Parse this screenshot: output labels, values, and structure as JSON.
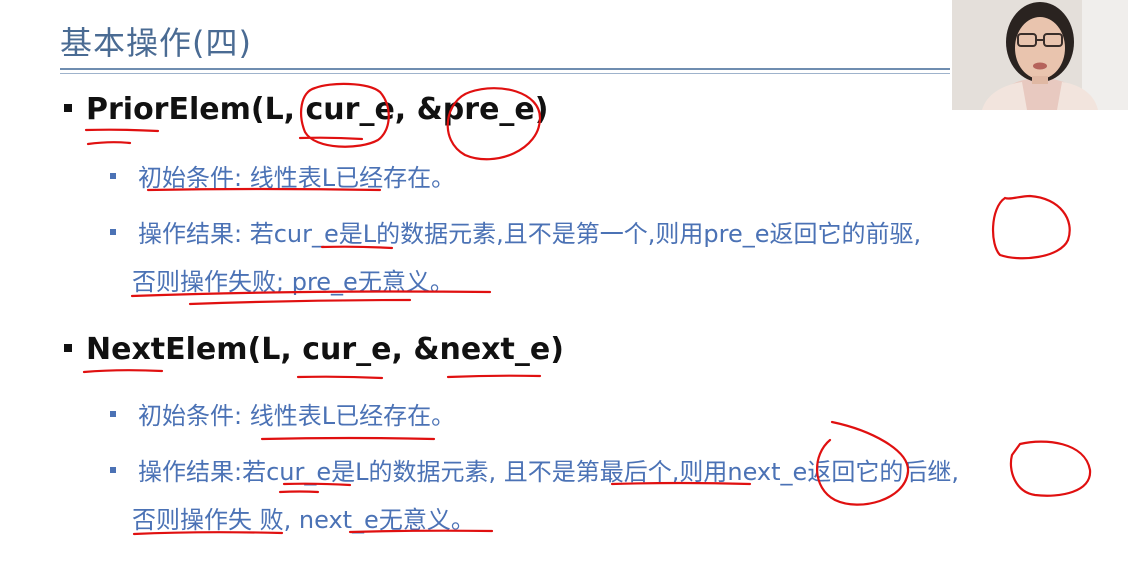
{
  "slide": {
    "title": "基本操作(四)",
    "sections": [
      {
        "heading": "PriorElem(L, cur_e, &pre_e)",
        "items": [
          "初始条件: 线性表L已经存在。",
          "操作结果:  若cur_e是L的数据元素,且不是第一个,则用pre_e返回它的前驱,",
          "否则操作失败;  pre_e无意义。"
        ]
      },
      {
        "heading": "NextElem(L, cur_e, &next_e)",
        "items": [
          "初始条件: 线性表L已经存在。",
          "操作结果:若cur_e是L的数据元素, 且不是第最后个,则用next_e返回它的后继,",
          "否则操作失  败, next_e无意义。"
        ]
      }
    ]
  },
  "colors": {
    "title": "#4a6b93",
    "body_text": "#4b72b5",
    "heading_text": "#111111",
    "annotation_ink": "#e01010"
  },
  "icons": [
    "bullet-square-icon",
    "presenter-webcam"
  ]
}
